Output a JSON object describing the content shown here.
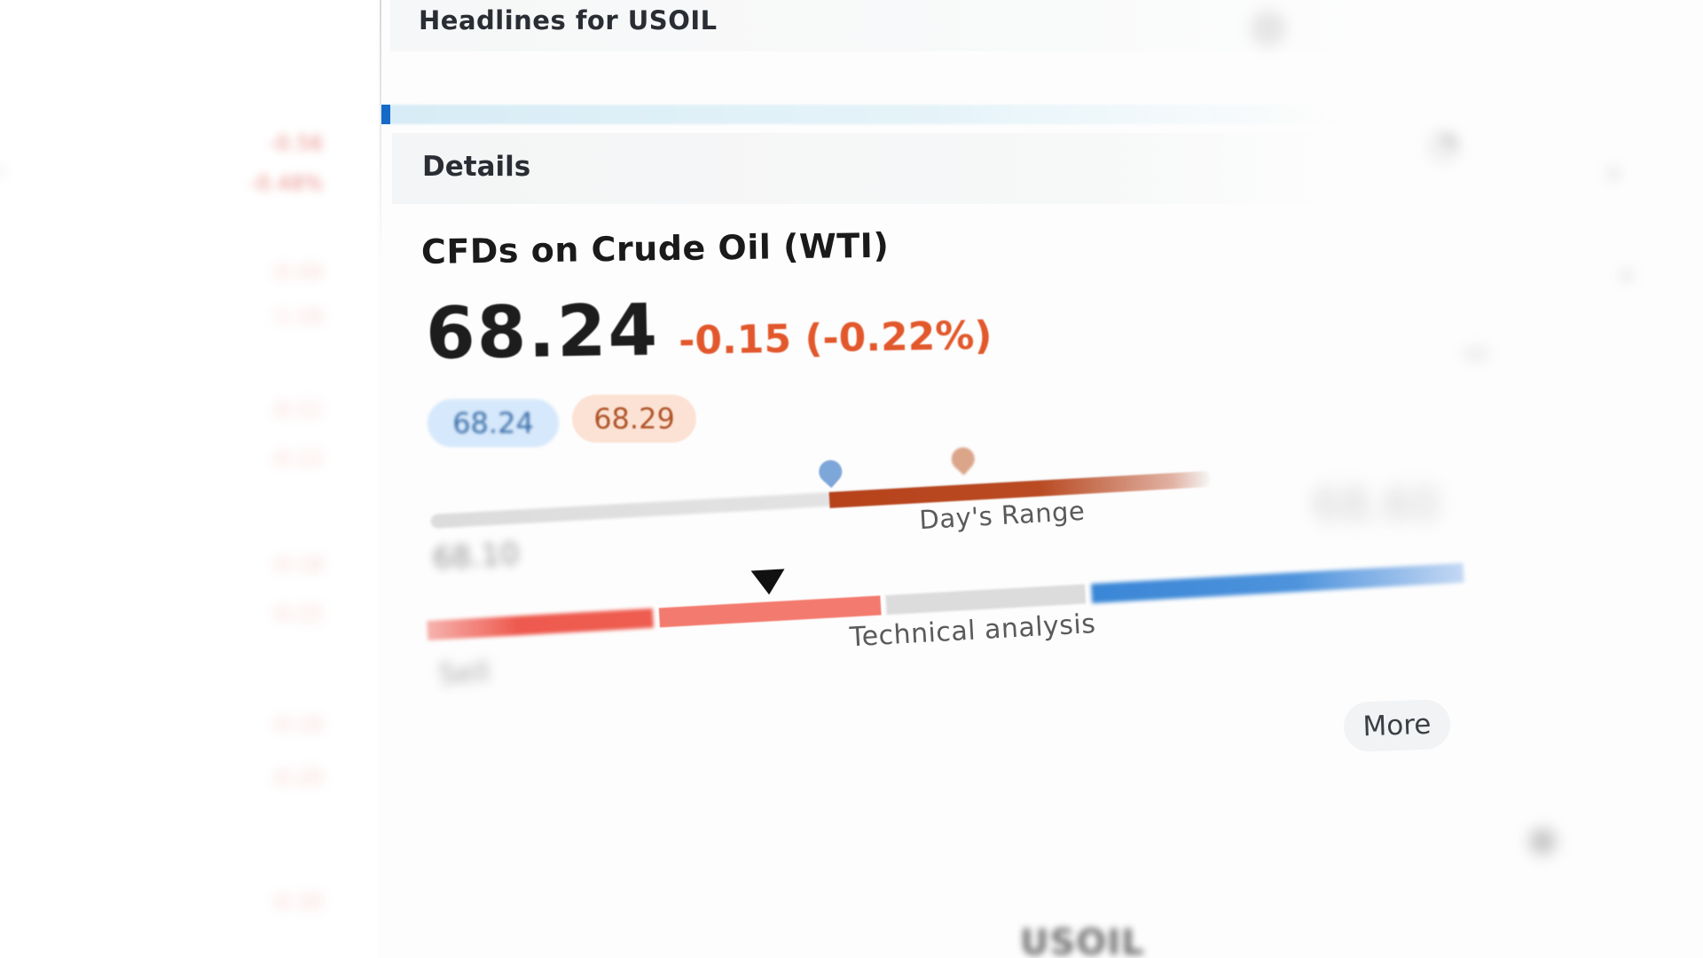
{
  "header": {
    "headlines_title": "Headlines for USOIL"
  },
  "details": {
    "section_title": "Details",
    "instrument_name": "CFDs on Crude Oil (WTI)",
    "last_price": "68.24",
    "change": "-0.15 (-0.22%)",
    "bid": "68.24",
    "ask": "68.29",
    "days_range": {
      "label": "Day's Range",
      "low_text": "68.10",
      "high_text": "68.60"
    },
    "technical_analysis": {
      "label": "Technical analysis",
      "summary": "Sell"
    },
    "more_label": "More"
  },
  "footer_partial": {
    "text": "USOIL"
  },
  "watchlist_left": [
    {
      "change": "-0.56"
    },
    {
      "change": "-0.48%"
    },
    {
      "change": "-0.44"
    },
    {
      "change": "-1.16"
    },
    {
      "change": "-0.11"
    },
    {
      "change": "-0.12"
    },
    {
      "change": "-0.18"
    },
    {
      "change": "-0.22"
    },
    {
      "change": "-0.16"
    },
    {
      "change": "-0.20"
    },
    {
      "change": "-0.30"
    }
  ],
  "colors": {
    "accent_blue": "#1569c7",
    "negative": "#e2582c",
    "range_fill": "#b7421a",
    "ta_sell": "#f37a6e",
    "ta_buy": "#3a86d6"
  }
}
